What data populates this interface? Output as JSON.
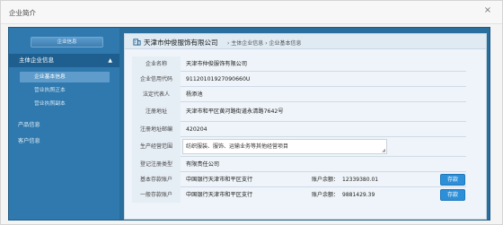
{
  "window": {
    "title": "企业简介",
    "close_glyph": "×"
  },
  "sidebar": {
    "header": "企业信息",
    "group": {
      "label": "主体企业信息",
      "arrow": "▲"
    },
    "sub_items": [
      {
        "label": "企业基本信息"
      },
      {
        "label": "营业执照正本"
      },
      {
        "label": "营业执照副本"
      }
    ],
    "items": [
      {
        "label": "产品信息"
      },
      {
        "label": "客户信息"
      }
    ]
  },
  "breadcrumb": {
    "company": "天津市仲俊服饰有限公司",
    "path": "› 主体企业信息 › 企业基本信息"
  },
  "fields": [
    {
      "label": "企业名称",
      "value": "天津市仲俊服饰有限公司"
    },
    {
      "label": "企业信用代码",
      "value": "91120101927090660U"
    },
    {
      "label": "法定代表人",
      "value": "杨添池"
    },
    {
      "label": "注册地址",
      "value": "天津市和平区黄河路街道永清路7642号"
    },
    {
      "label": "注册地址邮编",
      "value": "420204"
    },
    {
      "label": "生产经营范围",
      "value": "纺织服装、服饰、运输业务等其他经营项目"
    },
    {
      "label": "登记注册类型",
      "value": "有限责任公司"
    }
  ],
  "accounts": [
    {
      "label": "基本存款账户",
      "bank": "中国银行天津市和平区支行",
      "balance_label": "账户余额：",
      "balance": "12339380.01",
      "button": "存款"
    },
    {
      "label": "一般存款账户",
      "bank": "中国银行天津市和平区支行",
      "balance_label": "账户余额：",
      "balance": "9881429.39",
      "button": "存款"
    }
  ]
}
